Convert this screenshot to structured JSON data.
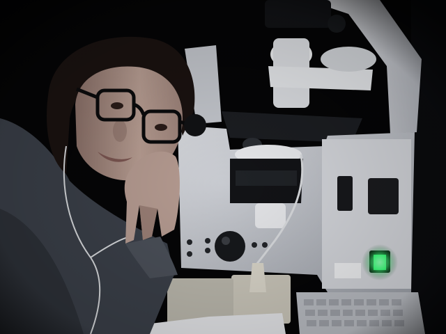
{
  "photo": {
    "colors": {
      "background": "#050506",
      "room_shadow": "#0d0e12",
      "microscope_body": "#c9ccd2",
      "microscope_shadow": "#8a8e96",
      "microscope_dark": "#16181c",
      "sweater": "#3a3f48",
      "skin": "#b49a90",
      "skin_shadow": "#6e5650",
      "hair": "#1a1210",
      "glasses": "#0b0b0c",
      "cable": "#d7d9dc",
      "power_led": "#3cff7a",
      "keyboard": "#b9bcc2",
      "paper": "#e2e3e6"
    }
  }
}
